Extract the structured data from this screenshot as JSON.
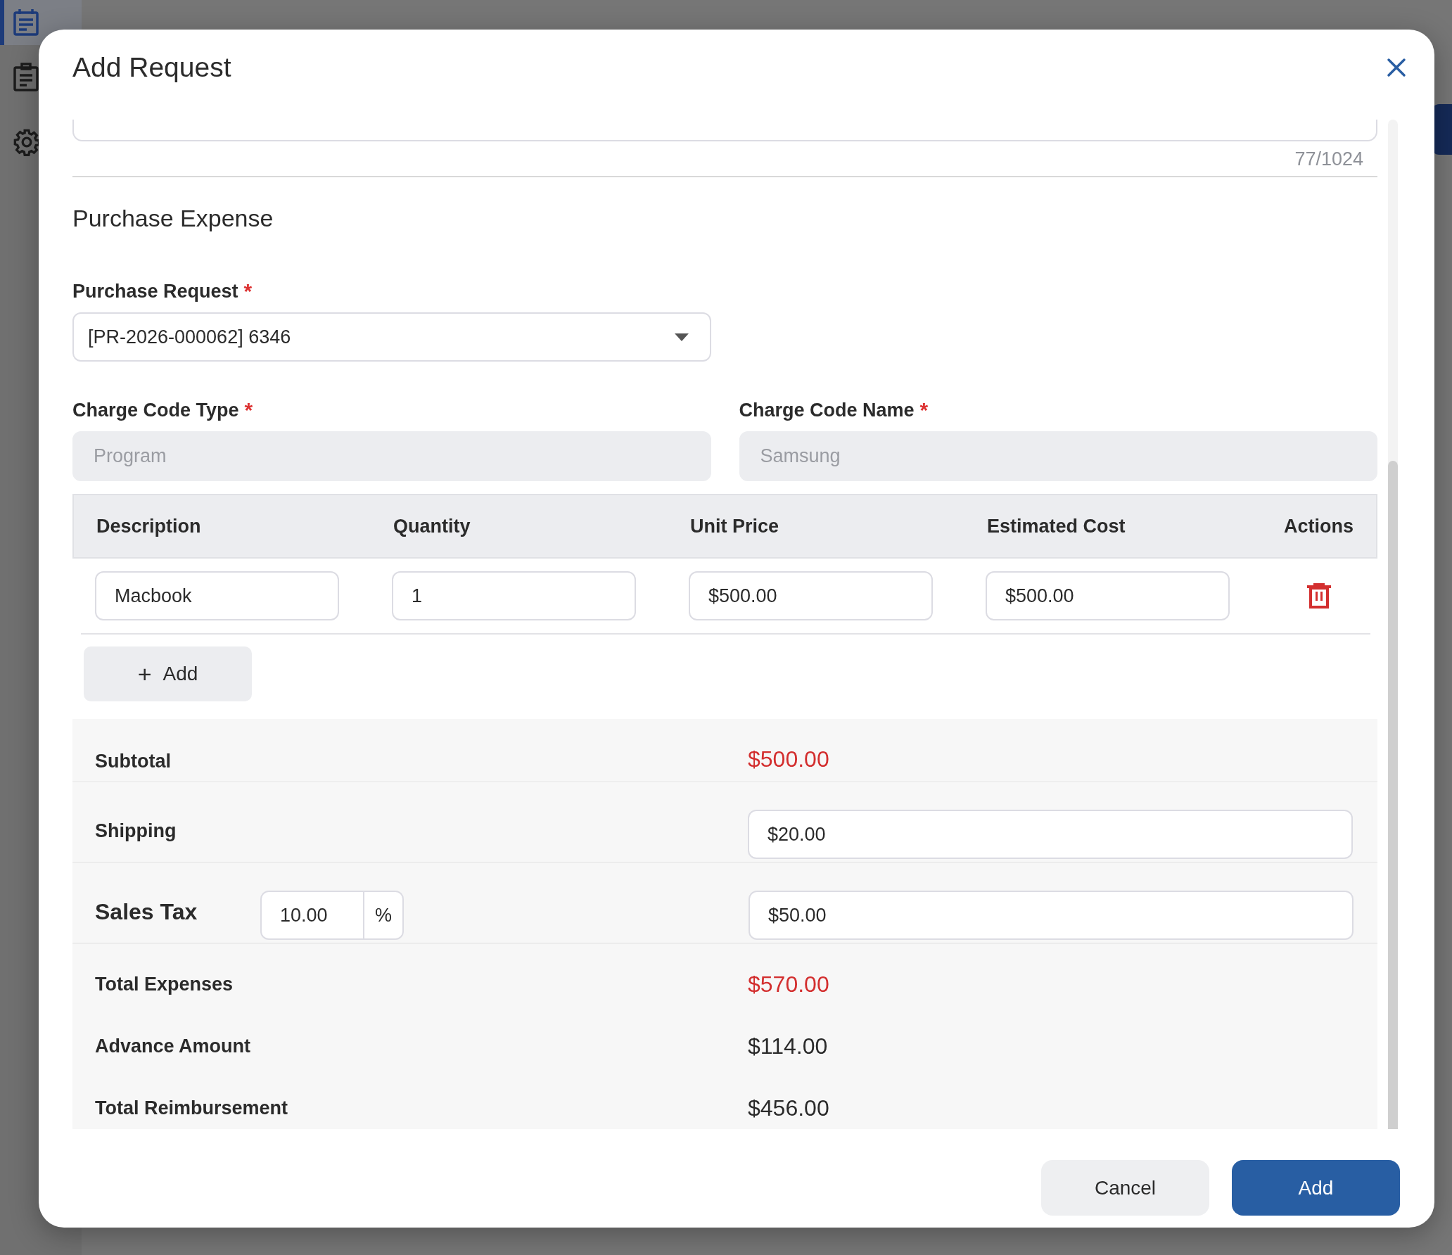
{
  "sidebar": {
    "items": [
      {
        "kind": "calendar",
        "selected": true
      },
      {
        "kind": "clipboard",
        "selected": false
      },
      {
        "kind": "gear",
        "selected": false
      }
    ]
  },
  "dialog": {
    "title": "Add Request",
    "description_counter": "77/1024",
    "section_title": "Purchase Expense",
    "purchase_request": {
      "label": "Purchase Request",
      "required_mark": "*",
      "value": "[PR-2026-000062] 6346"
    },
    "charge_fields": [
      {
        "label": "Charge Code Type",
        "required_mark": "*",
        "value": "Program",
        "disabled": true
      },
      {
        "label": "Charge Code Name",
        "required_mark": "*",
        "value": "Samsung",
        "disabled": true
      }
    ],
    "table": {
      "columns": [
        "Description",
        "Quantity",
        "Unit Price",
        "Estimated Cost",
        "Actions"
      ],
      "rows": [
        {
          "cells": [
            "Macbook",
            "1",
            "$500.00",
            "$500.00"
          ]
        }
      ]
    },
    "add_item_button": {
      "icon": "+",
      "label": "Add"
    },
    "summary": [
      {
        "kind": "amount",
        "label": "Subtotal",
        "value": "$500.00",
        "emphasis": true
      },
      {
        "kind": "input",
        "label": "Shipping",
        "value": "$20.00"
      },
      {
        "kind": "tax",
        "label": "Sales Tax",
        "rate": "10.00",
        "unit": "%",
        "value": "$50.00"
      },
      {
        "kind": "amount",
        "label": "Total Expenses",
        "value": "$570.00",
        "emphasis": true
      },
      {
        "kind": "amount",
        "label": "Advance Amount",
        "value": "$114.00",
        "emphasis": false
      },
      {
        "kind": "amount",
        "label": "Total Reimbursement",
        "value": "$456.00",
        "emphasis": false
      }
    ],
    "buttons": [
      {
        "kind": "secondary",
        "label": "Cancel"
      },
      {
        "kind": "primary",
        "label": "Add"
      }
    ]
  }
}
